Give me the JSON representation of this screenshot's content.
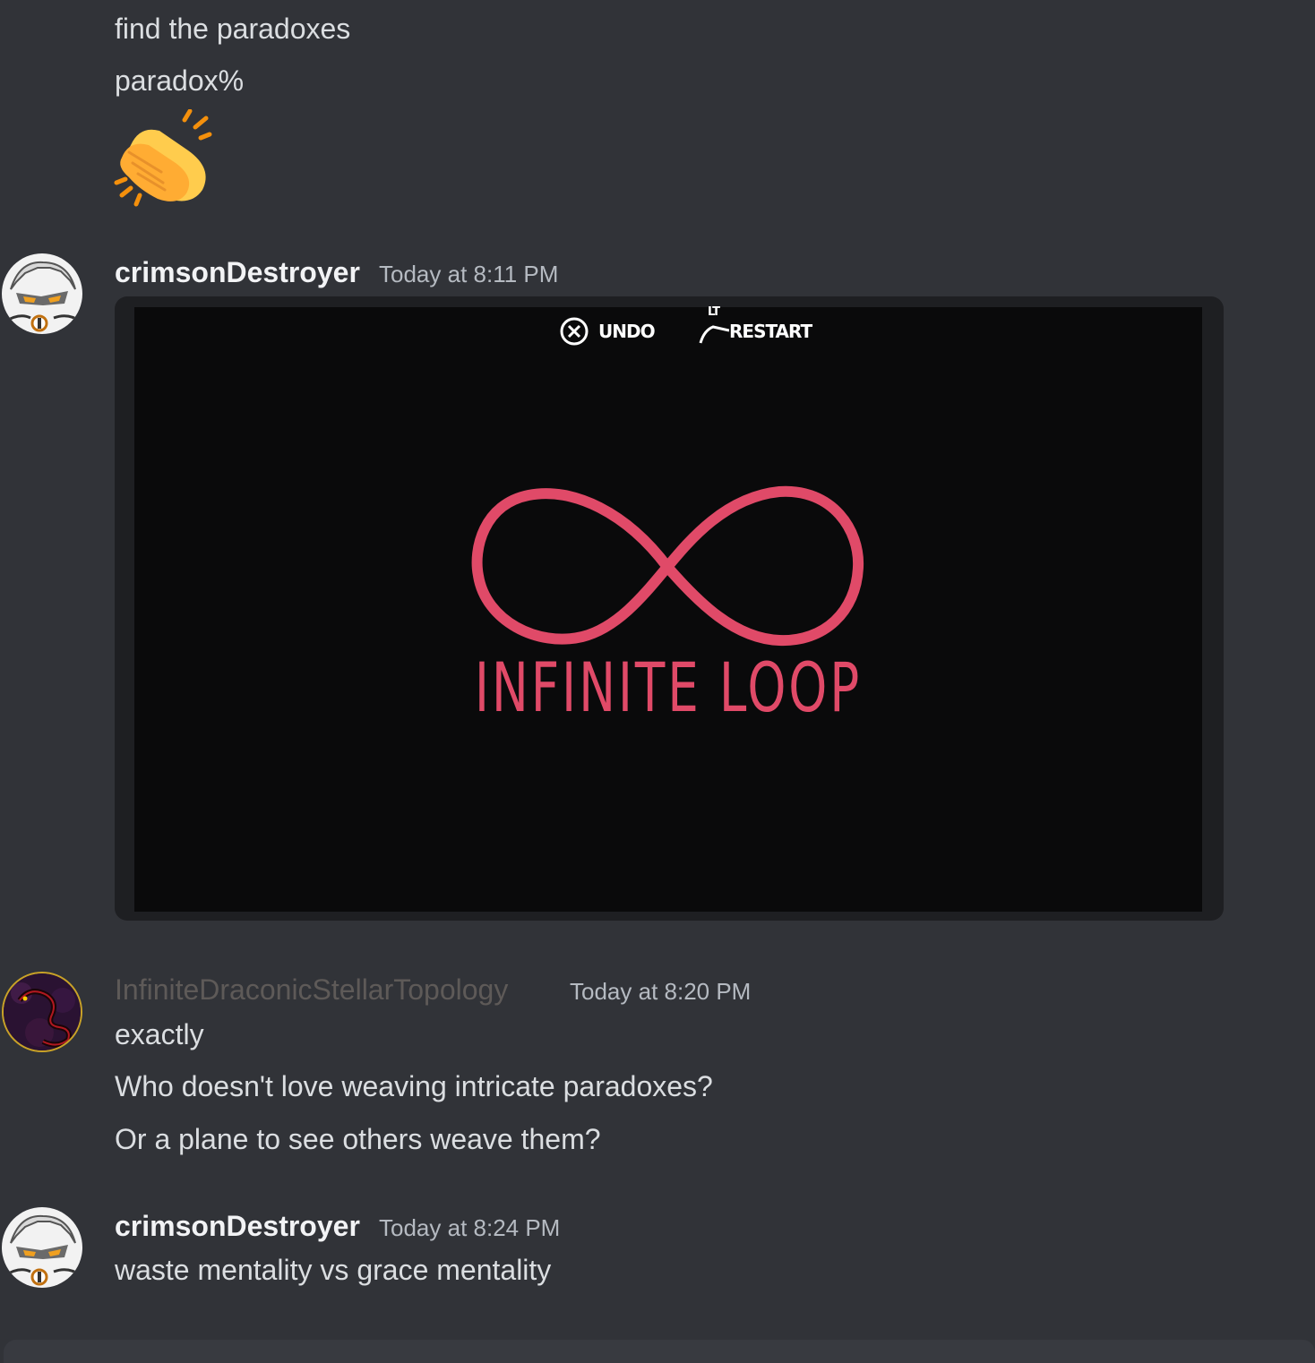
{
  "messages_top": {
    "line1": "find the paradoxes",
    "line2": "paradox%",
    "emoji": "clapping-hands"
  },
  "msg1": {
    "username": "crimsonDestroyer",
    "timestamp": "Today at 8:11 PM",
    "attachment": {
      "hud_undo": "UNDO",
      "hud_restart": "RESTART",
      "hud_lt": "LT",
      "title": "INFINITE LOOP",
      "accent": "#e04a68"
    }
  },
  "msg2": {
    "username": "InfiniteDraconicStellarTopology",
    "timestamp": "Today at 8:20 PM",
    "lines": [
      "exactly",
      "Who doesn't love weaving intricate paradoxes?",
      "Or a plane to see others weave them?"
    ]
  },
  "msg3": {
    "username": "crimsonDestroyer",
    "timestamp": "Today at 8:24 PM",
    "lines": [
      "waste mentality vs grace mentality"
    ]
  },
  "colors": {
    "background": "#313338",
    "text": "#dbdee1",
    "muted": "#b5bac1"
  }
}
